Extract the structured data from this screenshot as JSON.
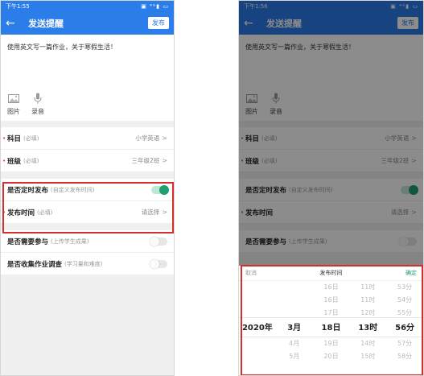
{
  "left": {
    "status_time": "下午1:55",
    "status_icons": "▣ ⁴ᴳ▮ ▭",
    "header": {
      "title": "发送提醒",
      "publish": "发布"
    },
    "content_text": "使用英文写一篇作业，关于寒假生活！",
    "attachments": [
      {
        "label": "图片"
      },
      {
        "label": "录音"
      }
    ],
    "rows": {
      "subject": {
        "label": "科目",
        "hint": "(必填)",
        "value": "小学英语",
        "star": "•"
      },
      "class": {
        "label": "班级",
        "hint": "(必填)",
        "value": "三年级2班",
        "star": "•"
      },
      "timed": {
        "label": "是否定时发布",
        "hint": "(自定义发布时间)"
      },
      "pubtime": {
        "label": "发布时间",
        "hint": "(必填)",
        "value": "请选择",
        "star": "•"
      },
      "participate": {
        "label": "是否需要参与",
        "hint": "(上传学生成果)"
      },
      "survey": {
        "label": "是否收集作业调查",
        "hint": "(学习量和难度)"
      }
    },
    "chevron": ">"
  },
  "right": {
    "status_time": "下午1:56",
    "status_icons": "▣ ⁴ᴳ▮ ▭",
    "header": {
      "title": "发送提醒",
      "publish": "发布"
    },
    "content_text": "使用英文写一篇作业，关于寒假生活！",
    "attachments": [
      {
        "label": "图片"
      },
      {
        "label": "录音"
      }
    ],
    "rows": {
      "subject": {
        "label": "科目",
        "hint": "(必填)",
        "value": "小学英语",
        "star": "•"
      },
      "class": {
        "label": "班级",
        "hint": "(必填)",
        "value": "三年级2班",
        "star": "•"
      },
      "timed": {
        "label": "是否定时发布",
        "hint": "(自定义发布时间)"
      },
      "pubtime": {
        "label": "发布时间",
        "value": "请选择",
        "star": "•"
      },
      "participate": {
        "label": "是否需要参与",
        "hint": "(上传学生成果)"
      }
    },
    "picker": {
      "cancel": "取消",
      "title": "发布时间",
      "confirm": "确定",
      "columns": [
        {
          "before": [
            "",
            "",
            ""
          ],
          "selected": "2020年",
          "after": [
            "",
            ""
          ]
        },
        {
          "before": [
            "",
            "",
            ""
          ],
          "selected": "3月",
          "after": [
            "4月",
            "5月"
          ]
        },
        {
          "before": [
            "16日",
            "16日",
            "17日"
          ],
          "selected": "18日",
          "after": [
            "19日",
            "20日"
          ]
        },
        {
          "before": [
            "11时",
            "11时",
            "12时"
          ],
          "selected": "13时",
          "after": [
            "14时",
            "15时"
          ]
        },
        {
          "before": [
            "53分",
            "54分",
            "55分"
          ],
          "selected": "56分",
          "after": [
            "57分",
            "58分"
          ]
        }
      ]
    },
    "chevron": ">"
  },
  "colors": {
    "primary": "#2b7de9",
    "toggle_on": "#1f9e6e",
    "highlight": "#d32f2f"
  }
}
